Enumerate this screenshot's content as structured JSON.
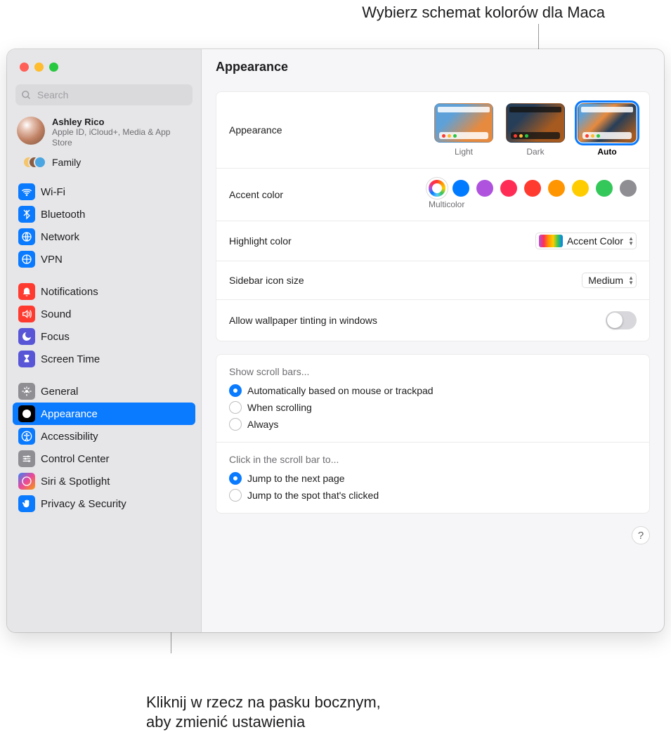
{
  "callouts": {
    "top": "Wybierz schemat kolorów dla Maca",
    "bottom": "Kliknij w rzecz na pasku bocznym,\naby zmienić ustawienia"
  },
  "window_title": "Appearance",
  "search_placeholder": "Search",
  "user": {
    "name": "Ashley Rico",
    "sub": "Apple ID, iCloud+, Media & App Store"
  },
  "family_label": "Family",
  "sidebar": [
    {
      "label": "Wi-Fi",
      "color": "ib-blue",
      "icon": "wifi"
    },
    {
      "label": "Bluetooth",
      "color": "ib-blue",
      "icon": "bluetooth"
    },
    {
      "label": "Network",
      "color": "ib-blue",
      "icon": "network"
    },
    {
      "label": "VPN",
      "color": "ib-blue",
      "icon": "globe"
    },
    {
      "spacer": true
    },
    {
      "label": "Notifications",
      "color": "ib-red",
      "icon": "bell"
    },
    {
      "label": "Sound",
      "color": "ib-red",
      "icon": "sound"
    },
    {
      "label": "Focus",
      "color": "ib-purple",
      "icon": "moon"
    },
    {
      "label": "Screen Time",
      "color": "ib-purple",
      "icon": "hourglass"
    },
    {
      "spacer": true
    },
    {
      "label": "General",
      "color": "ib-grey",
      "icon": "gear"
    },
    {
      "label": "Appearance",
      "color": "ib-black",
      "icon": "appearance",
      "selected": true
    },
    {
      "label": "Accessibility",
      "color": "ib-blue",
      "icon": "accessibility"
    },
    {
      "label": "Control Center",
      "color": "ib-grey",
      "icon": "sliders"
    },
    {
      "label": "Siri & Spotlight",
      "color": "ib-siri",
      "icon": "siri"
    },
    {
      "label": "Privacy & Security",
      "color": "ib-blue",
      "icon": "hand"
    }
  ],
  "panel1": {
    "appearance_label": "Appearance",
    "themes": [
      {
        "key": "light",
        "label": "Light"
      },
      {
        "key": "dark",
        "label": "Dark"
      },
      {
        "key": "auto",
        "label": "Auto",
        "selected": true
      }
    ],
    "accent_label": "Accent color",
    "accent_sublabel": "Multicolor",
    "accent_colors": [
      "multi",
      "#007aff",
      "#af52de",
      "#ff2d55",
      "#ff3b30",
      "#ff9500",
      "#ffcc00",
      "#34c759",
      "#8e8e93"
    ],
    "highlight_label": "Highlight color",
    "highlight_value": "Accent Color",
    "sidebar_size_label": "Sidebar icon size",
    "sidebar_size_value": "Medium",
    "tinting_label": "Allow wallpaper tinting in windows"
  },
  "panel2": {
    "scroll_header": "Show scroll bars...",
    "scroll_opts": [
      {
        "label": "Automatically based on mouse or trackpad",
        "selected": true
      },
      {
        "label": "When scrolling"
      },
      {
        "label": "Always"
      }
    ],
    "click_header": "Click in the scroll bar to...",
    "click_opts": [
      {
        "label": "Jump to the next page",
        "selected": true
      },
      {
        "label": "Jump to the spot that's clicked"
      }
    ]
  },
  "help": "?"
}
